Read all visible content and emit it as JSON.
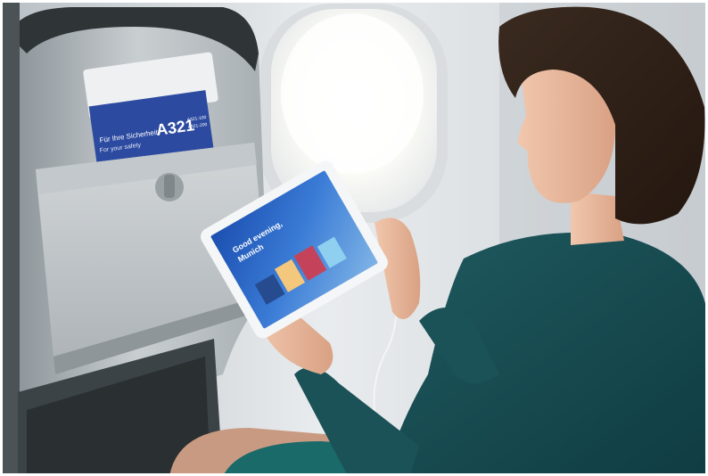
{
  "scene": {
    "seat_card": {
      "line1": "Für Ihre Sicherheit",
      "line2": "For your safety",
      "aircraft": "A321",
      "variant1": "A321-100",
      "variant2": "A321-200"
    },
    "tablet_screen": {
      "greeting_line1": "Good evening,",
      "greeting_line2": "Munich"
    }
  }
}
